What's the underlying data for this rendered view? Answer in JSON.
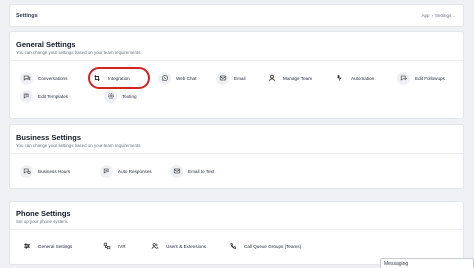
{
  "header": {
    "title": "Settings",
    "breadcrumb": [
      "App",
      "Settings"
    ],
    "breadcrumb_trailing": "..."
  },
  "general": {
    "title": "General Settings",
    "subtitle": "You can change your settings based on your team requirements.",
    "items": [
      {
        "label": "Conversations",
        "icon": "chat-bubbles-icon"
      },
      {
        "label": "Integration",
        "icon": "sync-arrows-icon",
        "highlighted": true
      },
      {
        "label": "Web Chat",
        "icon": "whatsapp-icon"
      },
      {
        "label": "Email",
        "icon": "email-icon"
      },
      {
        "label": "Manage Team",
        "icon": "person-icon"
      },
      {
        "label": "Automation",
        "icon": "bolt-icon"
      },
      {
        "label": "Edit Followups",
        "icon": "chat-edit-icon"
      },
      {
        "label": "Edit Templates",
        "icon": "template-icon"
      },
      {
        "label": "Texting",
        "icon": "gear-icon"
      }
    ]
  },
  "business": {
    "title": "Business Settings",
    "subtitle": "You can change your settings based on your team requirements.",
    "items": [
      {
        "label": "Business Hours",
        "icon": "chat-clock-icon"
      },
      {
        "label": "Auto Responses",
        "icon": "chat-auto-icon"
      },
      {
        "label": "Email to Text",
        "icon": "email-text-icon"
      }
    ]
  },
  "phone": {
    "title": "Phone Settings",
    "subtitle": "Set up your phone system.",
    "items": [
      {
        "label": "General Settings",
        "icon": "sliders-icon"
      },
      {
        "label": "IVR",
        "icon": "ivr-icon"
      },
      {
        "label": "Users & Extensions",
        "icon": "users-icon"
      },
      {
        "label": "Call Queue Groups (Teams)",
        "icon": "call-queue-icon"
      }
    ]
  },
  "bottom_popup": {
    "label": "Messaging"
  },
  "colors": {
    "background": "#eef0f3",
    "card": "#ffffff",
    "highlight": "#d32424",
    "icon_bg": "#eef0f3"
  }
}
